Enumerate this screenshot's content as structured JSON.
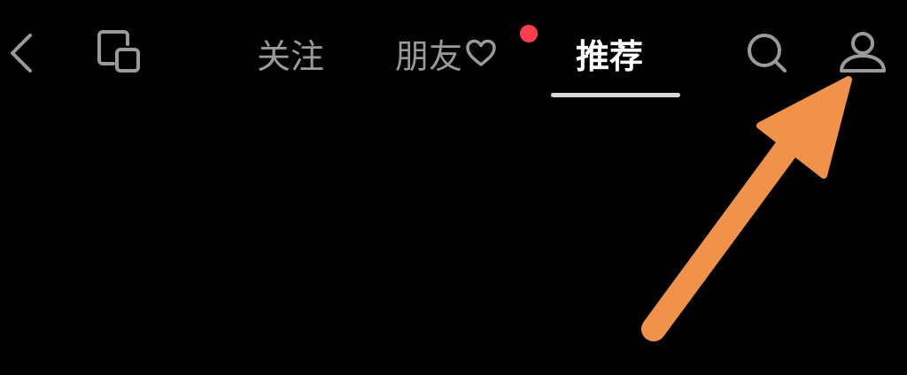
{
  "tabs": {
    "follow": "关注",
    "friends": "朋友",
    "recommend": "推荐"
  },
  "colors": {
    "background": "#000000",
    "inactive_tab": "#9a9a9a",
    "active_tab": "#ffffff",
    "underline": "#d8d8d8",
    "notification_dot": "#fb3e4e",
    "annotation_arrow": "#f0924a"
  },
  "icons": {
    "back": "chevron-left-icon",
    "window": "picture-in-picture-icon",
    "friends_suffix": "heart-icon",
    "search": "search-icon",
    "profile": "person-icon"
  }
}
